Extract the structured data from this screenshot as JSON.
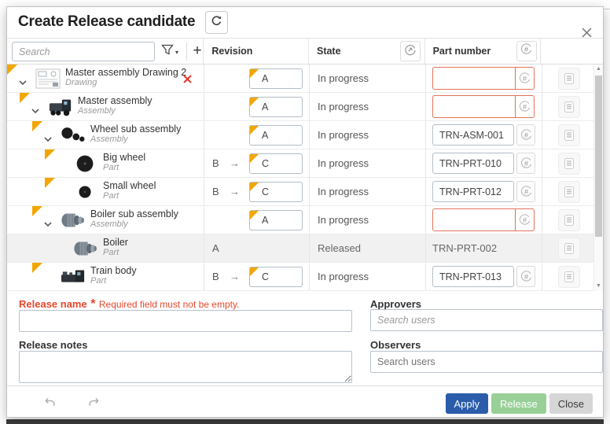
{
  "dialog": {
    "title": "Create Release candidate"
  },
  "toolbar": {
    "search_placeholder": "Search"
  },
  "table": {
    "columns": {
      "revision": "Revision",
      "state": "State",
      "part_number": "Part number"
    },
    "rows": [
      {
        "name": "Master assembly Drawing 2",
        "type": "Drawing",
        "level": 0,
        "icon": "drawing-icon",
        "expandable": true,
        "modified": true,
        "removable": true,
        "revision": {
          "prev": "",
          "value": "A",
          "editable": true
        },
        "state": "In progress",
        "part_number": {
          "value": "",
          "editable": true,
          "error": true
        },
        "released_row": false
      },
      {
        "name": "Master assembly",
        "type": "Assembly",
        "level": 1,
        "icon": "assembly-train-icon",
        "expandable": true,
        "modified": true,
        "removable": false,
        "revision": {
          "prev": "",
          "value": "A",
          "editable": true
        },
        "state": "In progress",
        "part_number": {
          "value": "",
          "editable": true,
          "error": true
        },
        "released_row": false
      },
      {
        "name": "Wheel sub assembly",
        "type": "Assembly",
        "level": 2,
        "icon": "wheels-icon",
        "expandable": true,
        "modified": true,
        "removable": false,
        "revision": {
          "prev": "",
          "value": "A",
          "editable": true
        },
        "state": "In progress",
        "part_number": {
          "value": "TRN-ASM-001",
          "editable": true,
          "error": false
        },
        "released_row": false
      },
      {
        "name": "Big wheel",
        "type": "Part",
        "level": 3,
        "icon": "big-wheel-icon",
        "expandable": false,
        "modified": true,
        "removable": false,
        "revision": {
          "prev": "B",
          "value": "C",
          "editable": true
        },
        "state": "In progress",
        "part_number": {
          "value": "TRN-PRT-010",
          "editable": true,
          "error": false
        },
        "released_row": false
      },
      {
        "name": "Small wheel",
        "type": "Part",
        "level": 3,
        "icon": "small-wheel-icon",
        "expandable": false,
        "modified": true,
        "removable": false,
        "revision": {
          "prev": "B",
          "value": "C",
          "editable": true
        },
        "state": "In progress",
        "part_number": {
          "value": "TRN-PRT-012",
          "editable": true,
          "error": false
        },
        "released_row": false
      },
      {
        "name": "Boiler sub assembly",
        "type": "Assembly",
        "level": 2,
        "icon": "boiler-icon",
        "expandable": true,
        "modified": true,
        "removable": false,
        "revision": {
          "prev": "",
          "value": "A",
          "editable": true
        },
        "state": "In progress",
        "part_number": {
          "value": "",
          "editable": true,
          "error": true
        },
        "released_row": false
      },
      {
        "name": "Boiler",
        "type": "Part",
        "level": 3,
        "icon": "boiler-icon",
        "expandable": false,
        "modified": false,
        "removable": false,
        "revision": {
          "prev": "",
          "value": "A",
          "editable": false
        },
        "state": "Released",
        "part_number": {
          "value": "TRN-PRT-002",
          "editable": false,
          "error": false
        },
        "released_row": true
      },
      {
        "name": "Train body",
        "type": "Part",
        "level": 2,
        "icon": "train-body-icon",
        "expandable": false,
        "modified": true,
        "removable": false,
        "revision": {
          "prev": "B",
          "value": "C",
          "editable": true
        },
        "state": "In progress",
        "part_number": {
          "value": "TRN-PRT-013",
          "editable": true,
          "error": false
        },
        "released_row": false
      }
    ]
  },
  "form": {
    "release_name_label": "Release name",
    "required_star": "*",
    "release_name_error": "Required field must not be empty.",
    "release_name_value": "",
    "release_notes_label": "Release notes",
    "release_notes_value": "",
    "approvers_label": "Approvers",
    "observers_label": "Observers",
    "search_users_placeholder": "Search users"
  },
  "footer": {
    "apply_label": "Apply",
    "release_label": "Release",
    "close_label": "Close"
  },
  "colors": {
    "yellow": "#f2a600",
    "error_border": "#e2735a",
    "red_text": "#e8472b",
    "apply_bg": "#2a5caa",
    "release_bg": "#98d098",
    "close_bg": "#d6d6d6"
  }
}
